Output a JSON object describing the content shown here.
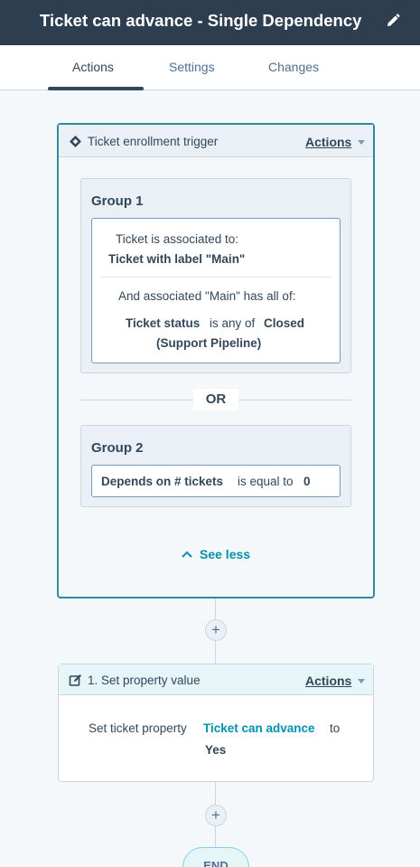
{
  "header": {
    "title": "Ticket can advance - Single Dependency"
  },
  "tabs": [
    {
      "label": "Actions"
    },
    {
      "label": "Settings"
    },
    {
      "label": "Changes"
    }
  ],
  "trigger": {
    "title": "Ticket enrollment trigger",
    "actions_label": "Actions",
    "group1": {
      "title": "Group 1",
      "assoc_line1": "Ticket is associated to:",
      "assoc_line2": "Ticket with label \"Main\"",
      "and_line": "And associated \"Main\" has all of:",
      "cond_prop": "Ticket status",
      "cond_op": "is any of",
      "cond_val1": "Closed",
      "cond_val2": "(Support Pipeline)"
    },
    "or_label": "OR",
    "group2": {
      "title": "Group 2",
      "cond_prop": "Depends on # tickets",
      "cond_op": "is equal to",
      "cond_val": "0"
    },
    "see_less": "See less"
  },
  "action1": {
    "title": "1. Set property value",
    "actions_label": "Actions",
    "body_prefix": "Set ticket property",
    "property": "Ticket can advance",
    "body_to": "to",
    "value": "Yes"
  },
  "plus_label": "+",
  "end_label": "END",
  "colors": {
    "header_bg": "#2d3e50",
    "accent_teal": "#0091ae",
    "trigger_border": "#2e8c96",
    "text": "#33475b"
  }
}
